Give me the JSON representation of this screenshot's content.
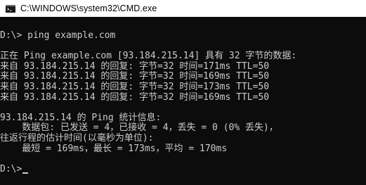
{
  "window": {
    "title": "C:\\WINDOWS\\system32\\CMD.exe",
    "icon": "cmd-console-icon"
  },
  "console": {
    "lines": [
      "D:\\> ping example.com",
      "",
      "正在 Ping example.com [93.184.215.14] 具有 32 字节的数据:",
      "来自 93.184.215.14 的回复: 字节=32 时间=171ms TTL=50",
      "来自 93.184.215.14 的回复: 字节=32 时间=169ms TTL=50",
      "来自 93.184.215.14 的回复: 字节=32 时间=173ms TTL=50",
      "来自 93.184.215.14 的回复: 字节=32 时间=169ms TTL=50",
      "",
      "93.184.215.14 的 Ping 统计信息:",
      "    数据包: 已发送 = 4，已接收 = 4，丢失 = 0 (0% 丢失)，",
      "往返行程的估计时间(以毫秒为单位):",
      "    最短 = 169ms，最长 = 173ms，平均 = 170ms",
      ""
    ],
    "prompt": "D:\\>"
  },
  "colors": {
    "background": "#0c0c0c",
    "text": "#cccccc",
    "titlebar": "#ffffff"
  }
}
